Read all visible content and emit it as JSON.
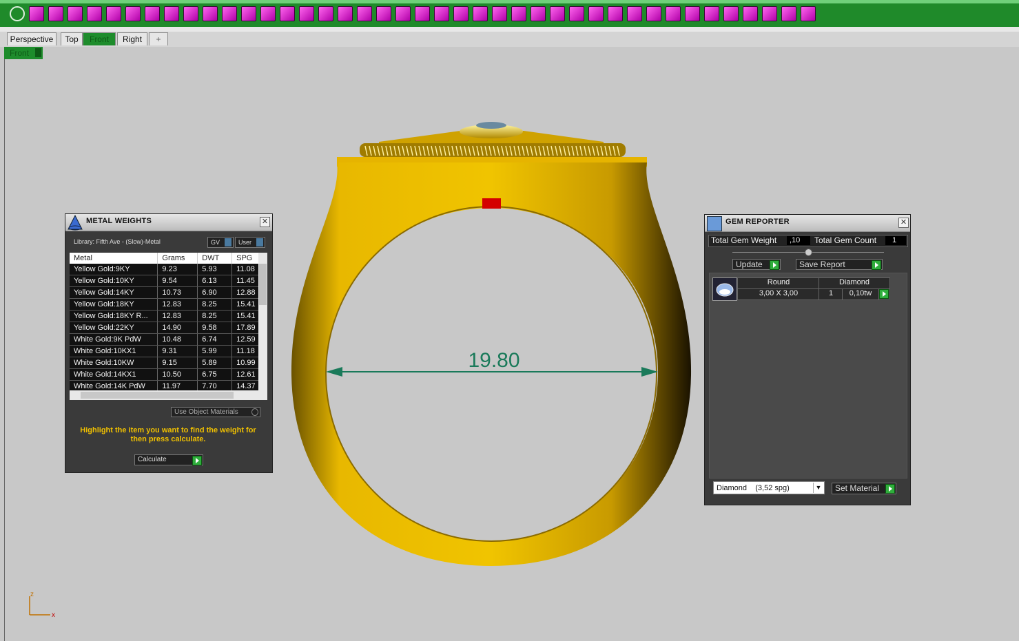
{
  "toolbar": {
    "icons": [
      "power-icon",
      "box-icon",
      "cube-icon",
      "tool-icon",
      "base-icon",
      "frame-icon",
      "curve-icon",
      "bend-icon",
      "twist-icon",
      "ring-icon",
      "arch-icon",
      "shape-icon",
      "surface-icon",
      "extrude-icon",
      "panel-icon",
      "grid-icon",
      "cube-cut-icon",
      "patch-icon",
      "square-grid-icon",
      "pink-grid-icon",
      "delete-icon",
      "pave-icon",
      "prong-icon",
      "gem-seat-icon",
      "claw-icon",
      "disc-icon",
      "dots-icon",
      "dotted-curve-icon",
      "stamp-icon",
      "scatter-icon",
      "tree-icon",
      "diamond-icon",
      "target-icon",
      "star-icon",
      "gem-icon",
      "bars-icon",
      "stack-icon",
      "tile-icon",
      "mesh-icon",
      "scissors-icon",
      "render-icon",
      "gear-icon"
    ]
  },
  "tabs": [
    "Perspective",
    "Top",
    "Front",
    "Right",
    "+"
  ],
  "active_tab": "Front",
  "viewport_label": "Front",
  "measurement": "19.80",
  "axis": {
    "z": "z",
    "x": "x"
  },
  "metal_weights": {
    "title": "METAL WEIGHTS",
    "library": "Library: Fifth Ave - (Slow)-Metal",
    "gv_label": "GV",
    "user_label": "User",
    "columns": [
      "Metal",
      "Grams",
      "DWT",
      "SPG"
    ],
    "rows": [
      [
        "Yellow Gold:9KY",
        "9.23",
        "5.93",
        "11.08"
      ],
      [
        "Yellow Gold:10KY",
        "9.54",
        "6.13",
        "11.45"
      ],
      [
        "Yellow Gold:14KY",
        "10.73",
        "6.90",
        "12.88"
      ],
      [
        "Yellow Gold:18KY",
        "12.83",
        "8.25",
        "15.41"
      ],
      [
        "Yellow Gold:18KY R...",
        "12.83",
        "8.25",
        "15.41"
      ],
      [
        "Yellow Gold:22KY",
        "14.90",
        "9.58",
        "17.89"
      ],
      [
        "White Gold:9K PdW",
        "10.48",
        "6.74",
        "12.59"
      ],
      [
        "White Gold:10KX1",
        "9.31",
        "5.99",
        "11.18"
      ],
      [
        "White Gold:10KW",
        "9.15",
        "5.89",
        "10.99"
      ],
      [
        "White Gold:14KX1",
        "10.50",
        "6.75",
        "12.61"
      ],
      [
        "White Gold:14K PdW",
        "11.97",
        "7.70",
        "14.37"
      ]
    ],
    "use_object_materials": "Use Object Materials",
    "hint": "Highlight the item you want to find the weight for then press calculate.",
    "calculate_label": "Calculate"
  },
  "gem_reporter": {
    "title": "GEM REPORTER",
    "total_weight_label": "Total Gem Weight",
    "total_weight_value": ",10",
    "total_count_label": "Total Gem Count",
    "total_count_value": "1",
    "update_label": "Update",
    "save_report_label": "Save Report",
    "gem": {
      "cut": "Round",
      "material": "Diamond",
      "size": "3,00 X 3,00",
      "count": "1",
      "weight": "0,10tw"
    },
    "material_select": "Diamond    (3,52 spg)",
    "set_material_label": "Set Material"
  },
  "colors": {
    "accent_green": "#1e8c2c",
    "gold": "#e6b800",
    "measure": "#1a7a5a",
    "panel_bg": "#3a3a3a"
  }
}
